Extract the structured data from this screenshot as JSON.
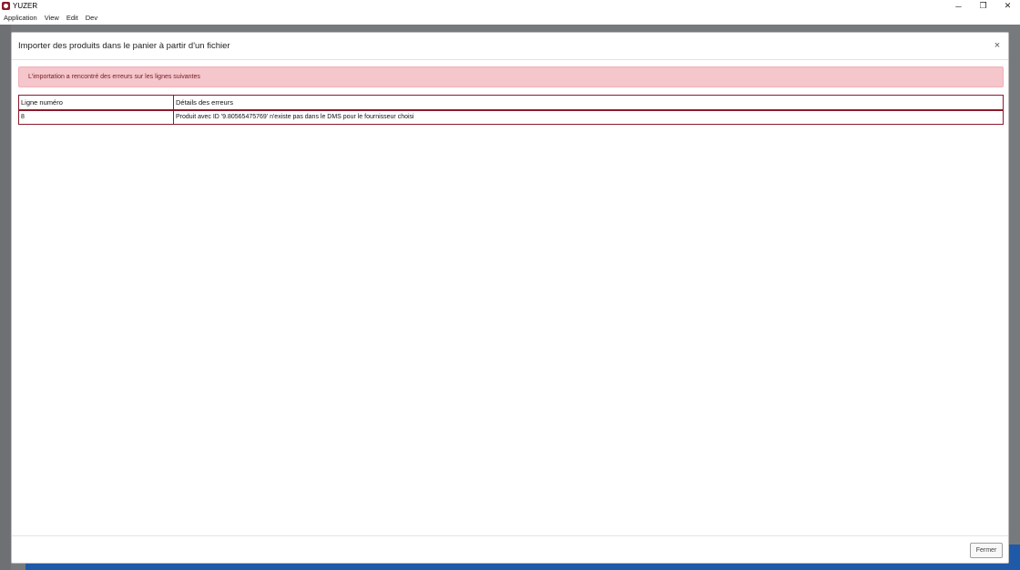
{
  "window": {
    "title": "YUZER",
    "controls": {
      "minimize": "─",
      "restore": "❐",
      "close": "✕"
    }
  },
  "menu": [
    "Application",
    "View",
    "Edit",
    "Dev"
  ],
  "modal": {
    "title": "Importer des produits dans le panier à partir d'un fichier",
    "close_glyph": "×",
    "alert": "L'importation a rencontré des erreurs sur les lignes suivantes",
    "table": {
      "headers": [
        "Ligne numéro",
        "Détails des erreurs"
      ],
      "rows": [
        [
          "8",
          "Produit avec ID '9.80565475769' n'existe pas dans le DMS pour le fournisseur choisi"
        ]
      ]
    },
    "footer_button": "Fermer"
  },
  "colors": {
    "alert_bg": "#f5c6cb",
    "table_border": "#8b1a2b",
    "backdrop": "#777a7d"
  }
}
